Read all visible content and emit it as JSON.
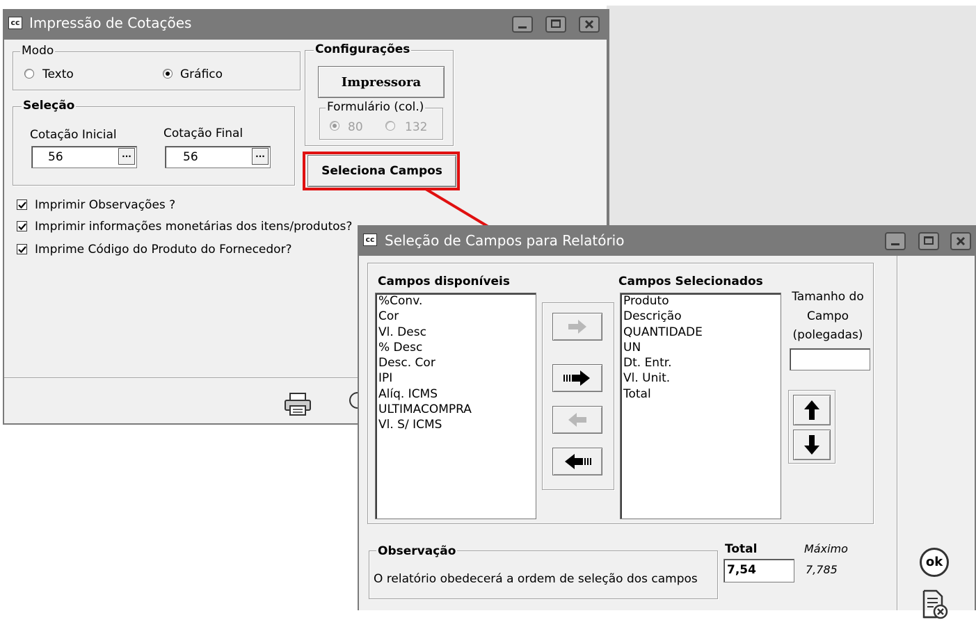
{
  "main_window": {
    "icon_text": "cc",
    "title": "Impressão de Cotações",
    "modo": {
      "legend": "Modo",
      "options": [
        {
          "label": "Texto",
          "selected": false
        },
        {
          "label": "Gráfico",
          "selected": true
        }
      ]
    },
    "selecao": {
      "legend": "Seleção",
      "cotacao_inicial_label": "Cotação Inicial",
      "cotacao_inicial_value": "56",
      "cotacao_final_label": "Cotação Final",
      "cotacao_final_value": "56",
      "ellipsis": "..."
    },
    "configuracoes": {
      "legend": "Configurações",
      "impressora_label": "Impressora",
      "formulario_legend": "Formulário (col.)",
      "col_options": [
        {
          "label": "80",
          "selected": true
        },
        {
          "label": "132",
          "selected": false
        }
      ]
    },
    "seleciona_campos_label": "Seleciona Campos",
    "checkboxes": [
      {
        "label": "Imprimir Observações ?",
        "checked": true
      },
      {
        "label": "Imprimir informações monetárias dos itens/produtos?",
        "checked": true
      },
      {
        "label": "Imprime Código do Produto do Fornecedor?",
        "checked": true
      }
    ]
  },
  "dialog": {
    "icon_text": "cc",
    "title": "Seleção de Campos para Relatório",
    "available_header": "Campos disponíveis",
    "available_fields": [
      "%Conv.",
      "Cor",
      "Vl. Desc",
      "% Desc",
      "Desc. Cor",
      "IPI",
      "Alíq. ICMS",
      "ULTIMACOMPRA",
      "Vl. S/ ICMS"
    ],
    "selected_header": "Campos Selecionados",
    "selected_fields": [
      "Produto",
      "Descrição",
      "QUANTIDADE",
      "UN",
      "Dt. Entr.",
      "Vl. Unit.",
      "Total"
    ],
    "field_size": {
      "label_line1": "Tamanho do",
      "label_line2": "Campo",
      "label_line3": "(polegadas)",
      "value": ""
    },
    "observacao": {
      "legend": "Observação",
      "text": "O relatório obedecerá a ordem de seleção dos campos"
    },
    "total": {
      "label": "Total",
      "value": "7,54"
    },
    "maximo": {
      "label": "Máximo",
      "value": "7,785"
    },
    "ok_label": "ok"
  },
  "colors": {
    "titlebar": "#7a7a7a",
    "client": "#f0f0f0",
    "highlight": "#e01010",
    "disabled_arrow": "#b0b0b0"
  },
  "icons": [
    "app-icon",
    "minimize-icon",
    "maximize-icon",
    "close-icon",
    "printer-icon",
    "arrow-right-icon",
    "arrow-right-all-icon",
    "arrow-left-icon",
    "arrow-left-all-icon",
    "arrow-up-icon",
    "arrow-down-icon",
    "ok-icon",
    "cancel-document-icon",
    "check-icon"
  ]
}
